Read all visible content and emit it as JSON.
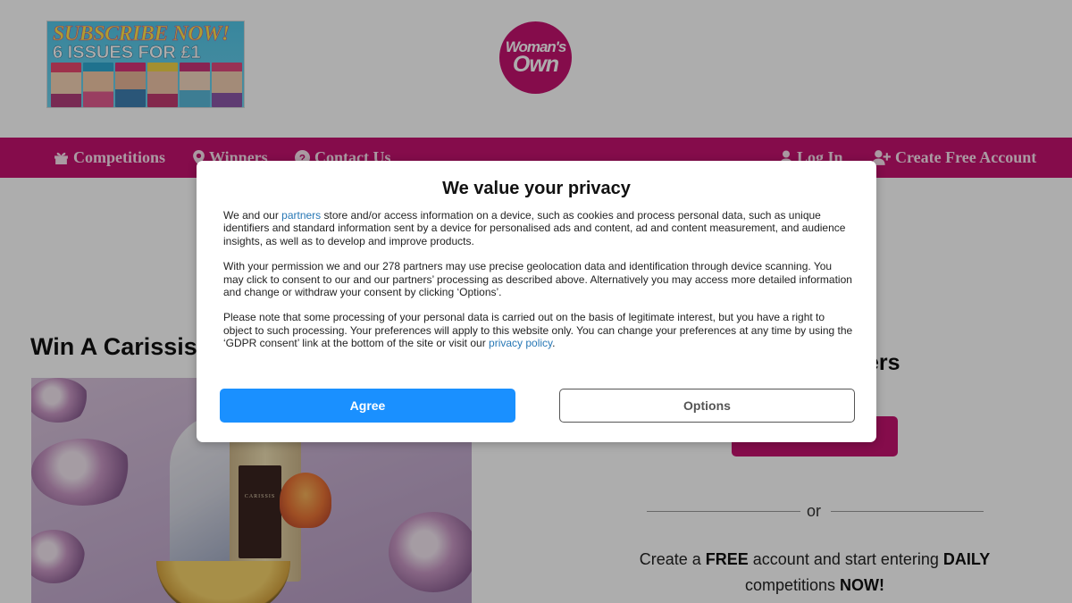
{
  "header": {
    "promo": {
      "line1": "SUBSCRIBE NOW!",
      "line2": "6 ISSUES FOR £1"
    },
    "logo": {
      "line1": "Woman's",
      "line2": "Own"
    }
  },
  "nav": {
    "items": [
      {
        "label": "Competitions",
        "icon": "gift-icon"
      },
      {
        "label": "Winners",
        "icon": "map-pin-icon"
      },
      {
        "label": "Contact Us",
        "icon": "question-circle-icon"
      },
      {
        "label": "Log In",
        "icon": "user-icon"
      },
      {
        "label": "Create Free Account",
        "icon": "user-plus-icon"
      }
    ]
  },
  "main": {
    "competition_title": "Win A Carissis",
    "bottle_label": "CARISSIS",
    "entry_heading": "ers",
    "or_text": "or",
    "cta": {
      "part1": "Create a ",
      "bold1": "FREE",
      "part2": " account and start entering ",
      "bold2": "DAILY",
      "part3": "competitions ",
      "bold3": "NOW!"
    }
  },
  "consent": {
    "title": "We value your privacy",
    "p1_before": "We and our ",
    "p1_link": "partners",
    "p1_after": " store and/or access information on a device, such as cookies and process personal data, such as unique identifiers and standard information sent by a device for personalised ads and content, ad and content measurement, and audience insights, as well as to develop and improve products.",
    "p2": "With your permission we and our 278 partners may use precise geolocation data and identification through device scanning. You may click to consent to our and our partners’ processing as described above. Alternatively you may access more detailed information and change or withdraw your consent by clicking ‘Options’.",
    "p3_before": "Please note that some processing of your personal data is carried out on the basis of legitimate interest, but you have a right to object to such processing. Your preferences will apply to this website only. You can change your preferences at any time by using the ‘GDPR consent’ link at the bottom of the site or visit our ",
    "p3_link": "privacy policy",
    "p3_after": ".",
    "agree_label": "Agree",
    "options_label": "Options"
  },
  "colors": {
    "brand": "#c5126f",
    "agree": "#1a90ff",
    "link": "#2878b5"
  }
}
